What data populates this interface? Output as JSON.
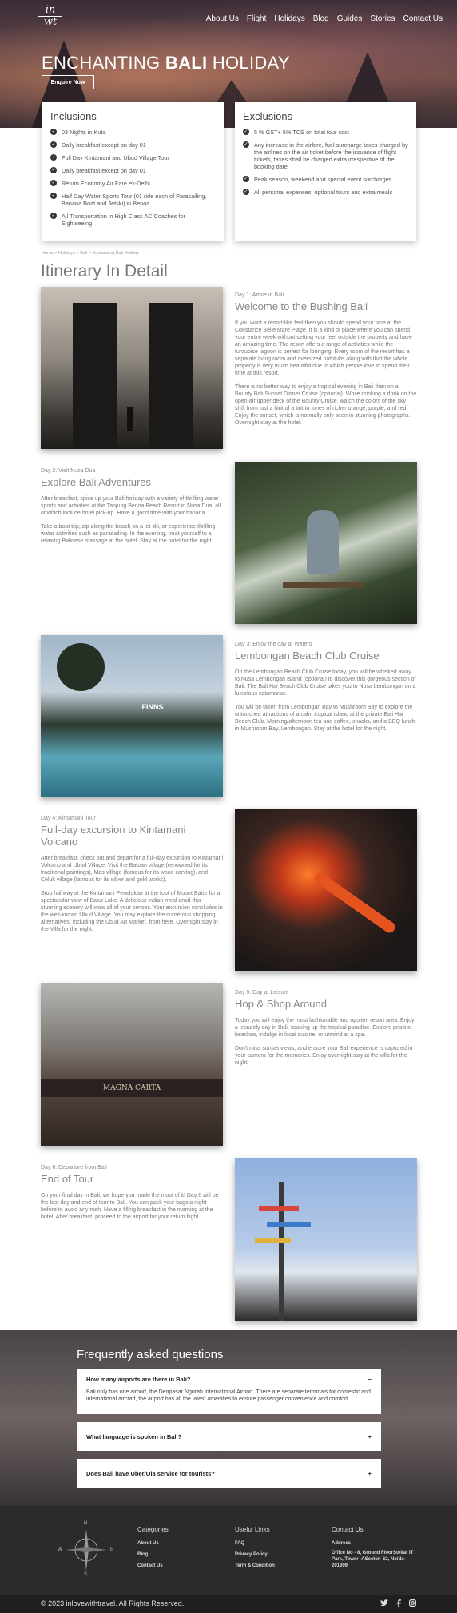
{
  "logo": {
    "line1": "in",
    "line2": "wt"
  },
  "nav": [
    "About Us",
    "Flight",
    "Holidays",
    "Blog",
    "Guides",
    "Stories",
    "Contact Us"
  ],
  "hero": {
    "title_pre": "ENCHANTING ",
    "title_bold": "BALI",
    "title_post": " HOLIDAY",
    "enquire": "Enquire Now"
  },
  "inclusions": {
    "title": "Inclusions",
    "items": [
      "03 Nights in Kuta",
      "Daily breakfast except on day 01",
      "Full Day Kintamani and Ubud Village Tour",
      "Daily breakfast except on day 01",
      "Return Economy Air Fare ex-Delhi",
      "Half Day Water Sports Tour (01 ride each of Parasailing, Banana Boat and Jetski) in Benoa",
      "All Transportation in High Class AC Coaches for Sightseeing"
    ]
  },
  "exclusions": {
    "title": "Exclusions",
    "items": [
      "5 % GST+ 5% TCS on total tour cost",
      "Any increase in the airfare, fuel surcharge taxes charged by the airlines on the air ticket before the issuance of flight tickets, taxes shall be charged extra irrespective of the booking date",
      "Peak season, weekend and special event surcharges",
      "All personal expenses, optional tours and extra meals"
    ]
  },
  "breadcrumb": "Home > Holidays > Bali > Enchanting Bali Holiday",
  "itinerary_title": "Itinerary In Detail",
  "days": [
    {
      "day": "Day 1: Arrive in Bali",
      "title": "Welcome to the Bushing Bali",
      "paras": [
        "If you want a resort-like feel then you should spend your time at the Constance Belle Mare Plage. It is a kind of place where you can spend your entire week without setting your feet outside the property and have an amazing time. The resort offers a range of activities while the turquoise lagoon is perfect for lounging. Every room of the resort has a separate living room and oversized bathtubs along with that the whole property is very much beautiful due to which people love to spend their time at this resort.",
        "There is no better way to enjoy a tropical evening in Bali than on a Bounty Bali Sunset Dinner Cruise (optional). While drinking a drink on the open-air upper deck of the Bounty Cruise, watch the colors of the sky shift from just a hint of a tint to tones of richer orange, purple, and red. Enjoy the sunset, which is normally only seen in stunning photographs. Overnight stay at the hotel."
      ],
      "image": "bali-temple-gate-photo"
    },
    {
      "day": "Day 2: Visit Nusa Dua",
      "title": "Explore Bali Adventures",
      "paras": [
        "After breakfast, spice up your Bali holiday with a variety of thrilling water sports and activities at the Tanjung Benoa Beach Resort in Nusa Dua, all of which include hotel pick-up. Have a good time with your banana.",
        "Take a boat trip, zip along the beach on a jet ski, or experience thrilling water activities such as parasailing. In the evening, treat yourself to a relaxing Balinese massage at the hotel. Stay at the hotel for the night."
      ],
      "image": "jungle-swing-photo"
    },
    {
      "day": "Day 3: Enjoy the day at Waters",
      "title": "Lembongan Beach Club Cruise",
      "paras": [
        "On the Lembongan Beach Club Cruise today, you will be whisked away to Nusa Lembongan Island (optional) to discover this gorgeous section of Bali. The Bali Hai Beach Club Cruise takes you to Nusa Lembongan on a luxurious catamaran.",
        "You will be taken from Lembongan Bay to Mushroom Bay to explore the untouched attractions of a calm tropical island at the private Bali Hai Beach Club. Morning/afternoon tea and coffee, snacks, and a BBQ lunch in Mushroom Bay, Lembongan. Stay at the hotel for the night."
      ],
      "image": "beach-club-pool-photo",
      "sign": "FINNS"
    },
    {
      "day": "Day 4: Kintamani Tour",
      "title": "Full-day excursion to Kintamani Volcano",
      "paras": [
        "After breakfast, check out and depart for a full-day excursion to Kintamani Volcano and Ubud Village. Visit the Batuan village (renowned for its traditional paintings), Mas village (famous for its wood carving), and Celuk village (famous for its silver and gold works).",
        "Stop halfway at the Kintamani Penelokan at the foot of Mount Batur for a spectacular view of Batur Lake. A delicious Indian meal amid this stunning scenery will wow all of your senses. Your excursion concludes in the well-known Ubud Village. You may explore the numerous shopping alternatives, including the Ubud Art Market, from here. Overnight stay in the Villa for the night."
      ],
      "image": "lava-flow-photo"
    },
    {
      "day": "Day 5: Day at Leisure",
      "title": "Hop & Shop Around",
      "paras": [
        "Today you will enjoy the most fashionable and opulent resort area. Enjoy a leisurely day in Bali, soaking up the tropical paradise. Explore pristine beaches, indulge in local cuisine, or unwind at a spa.",
        "Don't miss sunset views, and ensure your Bali experience is captured in your camera for the memories. Enjoy overnight stay at the villa for the night."
      ],
      "image": "street-shop-photo",
      "sign": "MAGNA CARTA"
    },
    {
      "day": "Day 6: Departure from Bali",
      "title": "End of Tour",
      "paras": [
        "On your final day in Bali, we hope you made the most of it! Day 6 will be the last day and end of tour to Bali. You can pack your bags a night before to avoid any rush. Have a filling breakfast in the morning at the hotel. After breakfast, proceed to the airport for your return flight."
      ],
      "image": "signpost-photo"
    }
  ],
  "faq": {
    "title": "Frequently asked questions",
    "items": [
      {
        "q": "How many airports are there in Bali?",
        "a": "Bali only has one airport, the Denpasar Ngurah International Airport. There are separate terminals for domestic and international aircraft, the airport has all the latest amenities to ensure passenger convenience and comfort.",
        "toggle": "−"
      },
      {
        "q": "What language is spoken in Bali?",
        "toggle": "+"
      },
      {
        "q": "Does Bali have Uber/Ola service for tourists?",
        "toggle": "+"
      }
    ]
  },
  "footer": {
    "categories": {
      "title": "Categories",
      "links": [
        "About Us",
        "Blog",
        "Contact Us"
      ]
    },
    "useful": {
      "title": "Useful Links",
      "links": [
        "FAQ",
        "Privacy Policy",
        "Term & Condition"
      ]
    },
    "contact": {
      "title": "Contact Us",
      "address_label": "Address",
      "address": "Office No - 8, Ground FloorStellar IT Park, Tower -ASector- 62, Noida- 201309"
    },
    "compass": {
      "n": "N",
      "s": "S",
      "e": "E",
      "w": "W"
    },
    "copyright": "© 2023 inlovewithtravel. All Rights Reserved."
  },
  "colors": {
    "accent": "#333333",
    "footer_bg": "#2b2b2b"
  }
}
